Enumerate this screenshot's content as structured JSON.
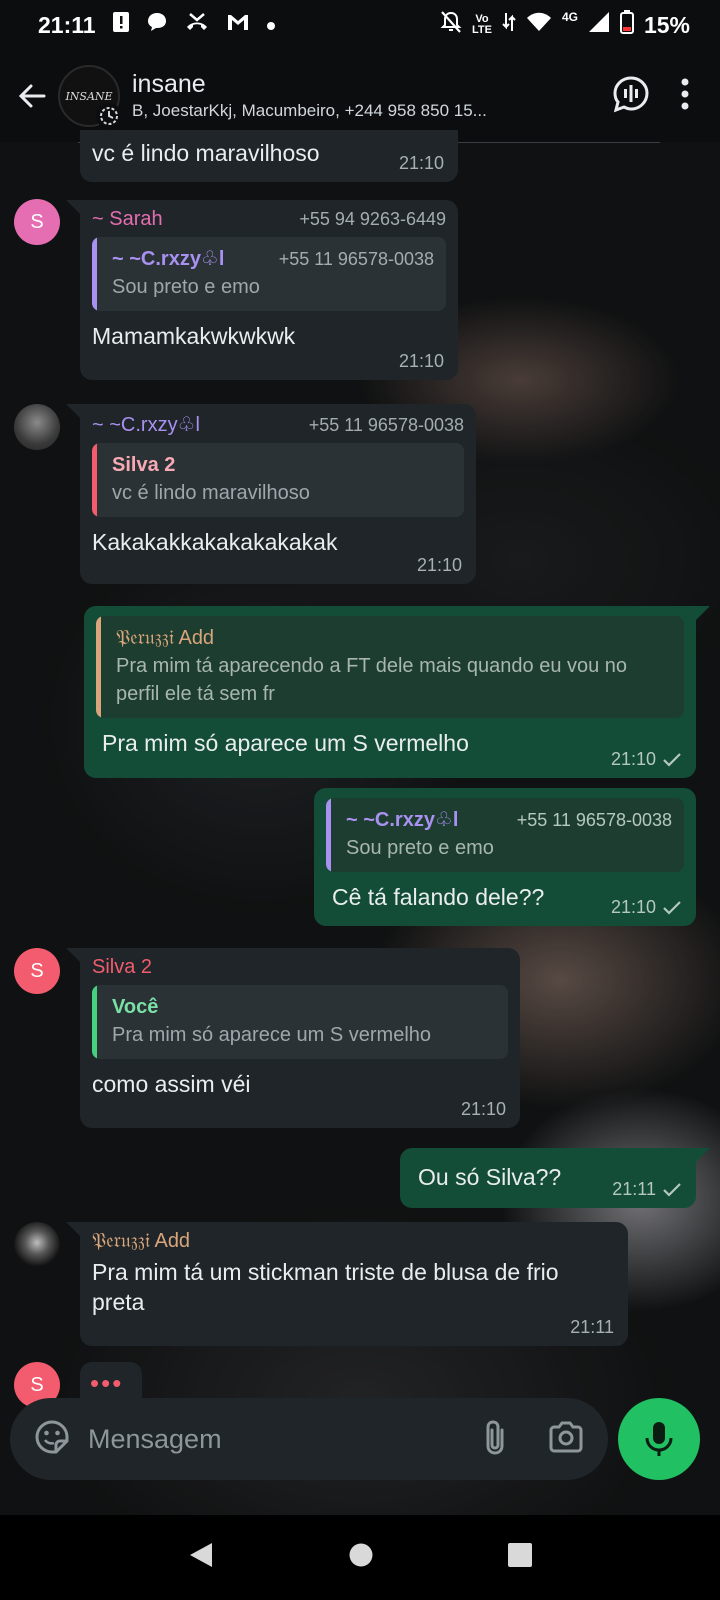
{
  "status_bar": {
    "time": "21:11",
    "network_top": "Vo",
    "network_bottom": "LTE",
    "signal_type": "4G",
    "battery": "15%",
    "icons_left": [
      "alert-icon",
      "chat-bubble-icon",
      "missed-call-icon",
      "gmail-icon",
      "dot-icon"
    ],
    "icons_right": [
      "mute-icon",
      "volte-icon",
      "data-icon",
      "wifi-icon",
      "signal-icon",
      "battery-icon"
    ]
  },
  "header": {
    "title": "insane",
    "members": "B, JoestarKkj, Macumbeiro, +244 958 850 15...",
    "avatar_text": "INSANE"
  },
  "messages": [
    {
      "text": "vc é lindo maravilhoso",
      "time": "21:10"
    },
    {
      "sender": "~ Sarah",
      "phone": "+55 94 9263-6449",
      "avatar_letter": "S",
      "quote": {
        "name": "~ ~C.rxzy♧l",
        "phone": "+55 11 96578-0038",
        "text": "Sou preto e emo"
      },
      "text": "Mamamkakwkwkwk",
      "time": "21:10"
    },
    {
      "sender": "~ ~C.rxzy♧l",
      "phone": "+55 11 96578-0038",
      "quote": {
        "name": "Silva 2",
        "text": "vc é lindo maravilhoso"
      },
      "text": "Kakakakkakakakakakak",
      "time": "21:10"
    },
    {
      "quote": {
        "name": "𝔓𝔢𝔯𝔲𝔷𝔷𝔦 Add",
        "text": "Pra mim tá aparecendo a FT dele mais quando eu vou no perfil ele tá sem fr"
      },
      "text": "Pra mim só aparece um S vermelho",
      "time": "21:10"
    },
    {
      "quote": {
        "name": "~ ~C.rxzy♧l",
        "phone": "+55 11 96578-0038",
        "text": "Sou preto e emo"
      },
      "text": "Cê tá falando dele??",
      "time": "21:10"
    },
    {
      "sender": "Silva 2",
      "avatar_letter": "S",
      "quote": {
        "name": "Você",
        "text": "Pra mim só aparece um S vermelho"
      },
      "text": "como assim véi",
      "time": "21:10"
    },
    {
      "text": "Ou só Silva??",
      "time": "21:11"
    },
    {
      "sender": "𝔓𝔢𝔯𝔲𝔷𝔷𝔦 Add",
      "text": "Pra mim tá um  stickman triste de blusa de frio preta",
      "time": "21:11"
    },
    {
      "avatar_letter": "S",
      "typing": "•••"
    }
  ],
  "colors": {
    "sarah": "#e56eb3",
    "crxzy": "#a891f0",
    "silva": "#f25c6e",
    "peruzzi": "#d9a57b",
    "voce": "#46d17f",
    "accent_green": "#21c063"
  },
  "input": {
    "placeholder": "Mensagem"
  }
}
